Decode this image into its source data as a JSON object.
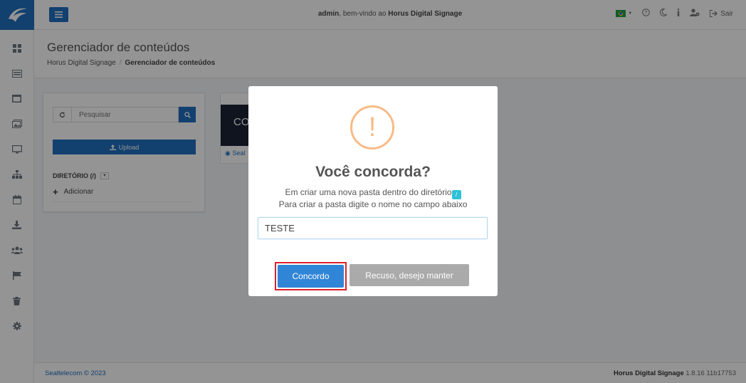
{
  "topbar": {
    "welcome_user": "admin",
    "welcome_mid": ", bem-vindo ao ",
    "welcome_app": "Horus Digital Signage",
    "logout_label": "Sair"
  },
  "header": {
    "title": "Gerenciador de conteúdos",
    "breadcrumb": [
      "Horus Digital Signage",
      "Gerenciador de conteúdos"
    ]
  },
  "sidebar": {
    "icons": [
      "dashboard-icon",
      "player-icon",
      "layout-icon",
      "media-icon",
      "display-icon",
      "network-icon",
      "calendar-icon",
      "download-icon",
      "users-icon",
      "flag-icon",
      "trash-icon",
      "settings-icon"
    ]
  },
  "panel": {
    "search_placeholder": "Pesquisar",
    "upload_label": "Upload",
    "directory_label": "DIRETÓRIO (/)",
    "add_label": "Adicionar"
  },
  "thumb": {
    "text": "CO",
    "link_label": "Seal"
  },
  "footer": {
    "copyright": "Sealtelecom © 2023",
    "app_name": "Horus Digital Signage",
    "version": " 1.8.16 11b17753"
  },
  "modal": {
    "title": "Você concorda?",
    "line1": "Em criar uma nova pasta dentro do diretório",
    "line2": "Para criar a pasta digite o nome no campo abaixo",
    "input_value": "TESTE",
    "confirm_label": "Concordo",
    "cancel_label": "Recuso, desejo manter"
  },
  "colors": {
    "primary": "#1f6fbf",
    "confirm": "#3085d6",
    "cancel": "#aaaaaa",
    "warning": "#f8bb86",
    "highlight": "#d9232a"
  }
}
